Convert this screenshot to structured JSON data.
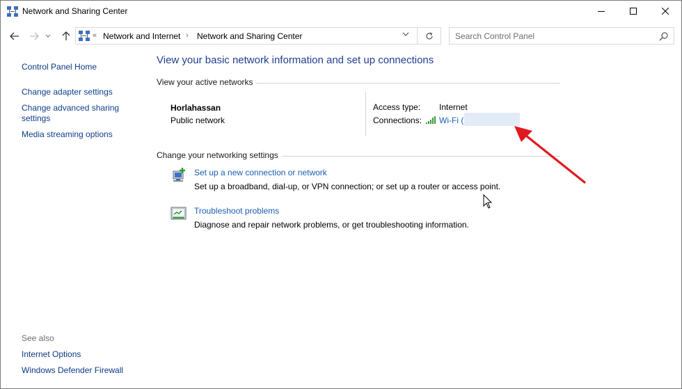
{
  "window": {
    "title": "Network and Sharing Center",
    "controls": {
      "minimize": "—",
      "maximize": "☐",
      "close": "✕"
    }
  },
  "address_bar": {
    "breadcrumb_prefix": "«",
    "crumbs": [
      "Network and Internet",
      "Network and Sharing Center"
    ],
    "separator": "›"
  },
  "search": {
    "placeholder": "Search Control Panel"
  },
  "sidebar": {
    "home": "Control Panel Home",
    "links": [
      "Change adapter settings",
      "Change advanced sharing settings",
      "Media streaming options"
    ],
    "see_also_label": "See also",
    "see_also": [
      "Internet Options",
      "Windows Defender Firewall"
    ]
  },
  "main": {
    "title": "View your basic network information and set up connections",
    "active_networks_header": "View your active networks",
    "network": {
      "name": "Horlahassan",
      "type": "Public network",
      "access_type_label": "Access type:",
      "access_type_value": "Internet",
      "connections_label": "Connections:",
      "connections_value": "Wi-Fi ("
    },
    "change_settings_header": "Change your networking settings",
    "tasks": [
      {
        "link": "Set up a new connection or network",
        "desc": "Set up a broadband, dial-up, or VPN connection; or set up a router or access point."
      },
      {
        "link": "Troubleshoot problems",
        "desc": "Diagnose and repair network problems, or get troubleshooting information."
      }
    ]
  },
  "colors": {
    "link": "#1a5fb4",
    "title": "#1e3f8f",
    "annotation_arrow": "#e0191e",
    "redaction": "#e3ebf7"
  }
}
